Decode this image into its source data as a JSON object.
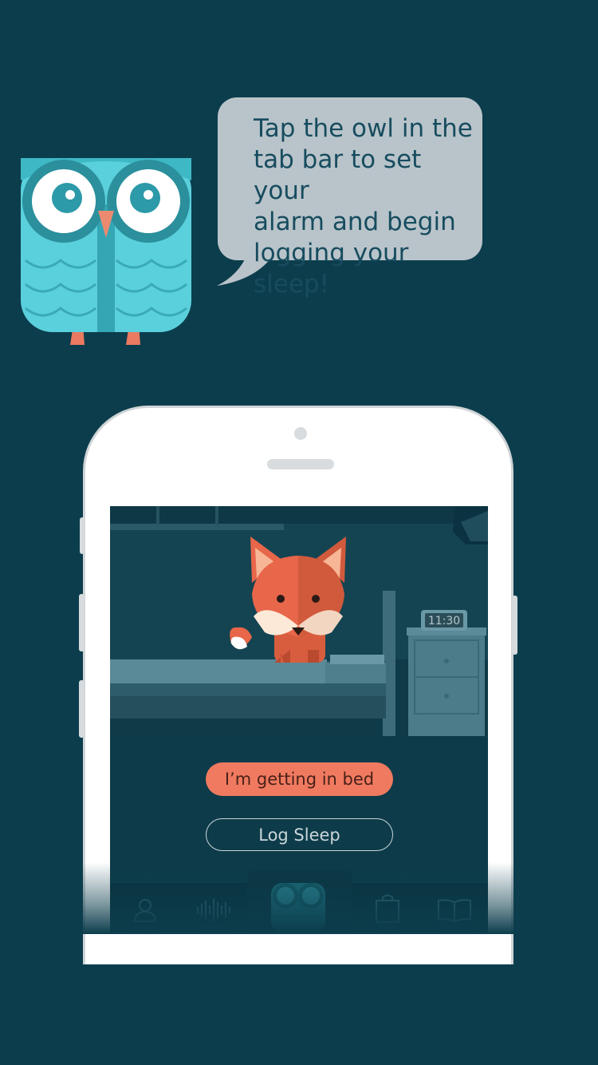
{
  "tip": {
    "lines": [
      "Tap the owl in the",
      "tab bar to set your",
      "alarm and begin",
      "logging your sleep!"
    ]
  },
  "scene": {
    "clock_time": "11:30"
  },
  "buttons": {
    "getting_in_bed": "I’m getting in bed",
    "log_sleep": "Log Sleep"
  },
  "tabbar": {
    "items": [
      {
        "icon": "profile-icon",
        "label": "Profile"
      },
      {
        "icon": "sounds-waveform-icon",
        "label": "Sounds"
      },
      {
        "icon": "owl-alarm-icon",
        "label": ""
      },
      {
        "icon": "store-bag-icon",
        "label": "Store"
      },
      {
        "icon": "stories-book-icon",
        "label": "Stories"
      }
    ]
  },
  "colors": {
    "background": "#0c3d4c",
    "accent": "#f07a60",
    "bubble": "#b9c4ca",
    "owl": "#5ad0dc"
  }
}
